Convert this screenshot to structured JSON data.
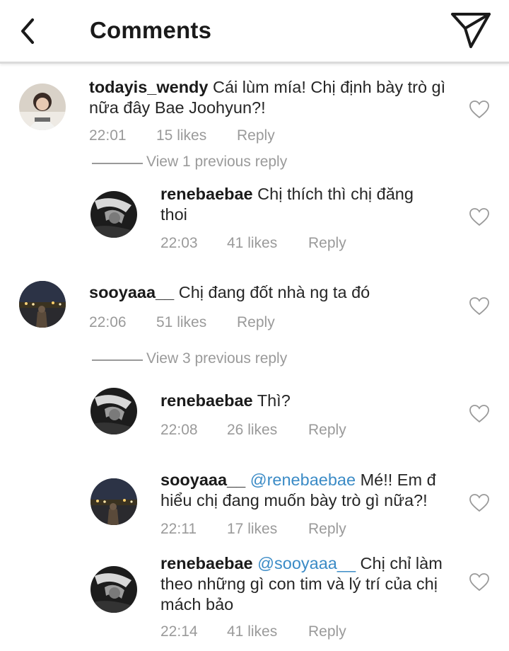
{
  "header": {
    "title": "Comments",
    "back_icon": "chevron-left-icon",
    "send_icon": "paper-plane-icon"
  },
  "comments": [
    {
      "username": "todayis_wendy",
      "text_line1": "Cái lùm mía! Chị định bày trò gì",
      "text_line2": "nữa đây Bae Joohyun?!",
      "time": "22:01",
      "likes": "15 likes",
      "reply": "Reply"
    },
    {
      "view_previous": "View 1 previous reply",
      "username": "renebaebae",
      "text_line1": "Chị thích thì chị đăng",
      "text_line2": "thoi",
      "time": "22:03",
      "likes": "41 likes",
      "reply": "Reply"
    },
    {
      "username": "sooyaaa__",
      "text_line1": "Chị đang đốt nhà ng ta đó",
      "time": "22:06",
      "likes": "51 likes",
      "reply": "Reply"
    },
    {
      "view_previous": "View 3 previous reply",
      "username": "renebaebae",
      "text_line1": "Thì?",
      "time": "22:08",
      "likes": "26 likes",
      "reply": "Reply"
    },
    {
      "username": "sooyaaa__",
      "mention": "@renebaebae",
      "text_line1": "Mé!! Em đ",
      "text_line2": "hiểu chị đang muốn bày trò gì nữa?!",
      "time": "22:11",
      "likes": "17 likes",
      "reply": "Reply"
    },
    {
      "username": "renebaebae",
      "mention": "@sooyaaa__",
      "text_line1": "Chị chỉ làm",
      "text_line2": "theo những gì con tim và lý trí của chị",
      "text_line3": "mách bảo",
      "time": "22:14",
      "likes": "41 likes",
      "reply": "Reply"
    }
  ],
  "colors": {
    "text": "#262626",
    "meta": "#9a9a9a",
    "mention": "#3b8bc6",
    "divider": "#dbdbdb"
  }
}
